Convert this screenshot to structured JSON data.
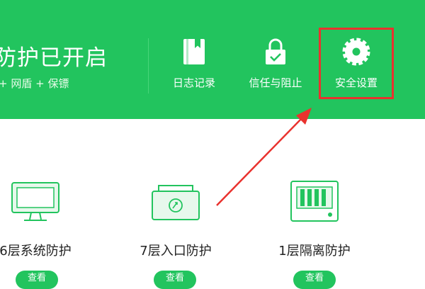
{
  "header": {
    "status_title": "防护已开启",
    "status_subtitle": "+ 网盾 + 保镖"
  },
  "toolbar": {
    "log_label": "日志记录",
    "trust_label": "信任与阻止",
    "settings_label": "安全设置"
  },
  "cards": [
    {
      "name": "6层系统防护",
      "button": "查看"
    },
    {
      "name": "7层入口防护",
      "button": "查看"
    },
    {
      "name": "1层隔离防护",
      "button": "查看"
    }
  ],
  "colors": {
    "brand_green": "#22c45e",
    "highlight_red": "#e9322e"
  }
}
